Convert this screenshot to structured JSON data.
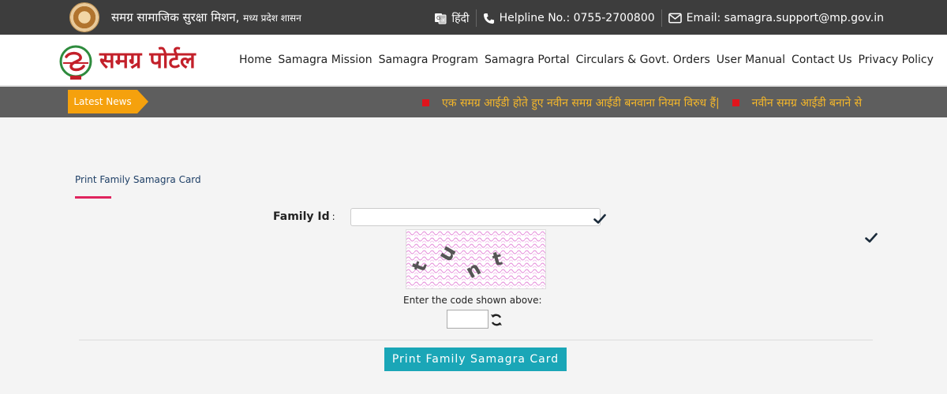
{
  "topbar": {
    "org_name": "समग्र सामाजिक सुरक्षा मिशन,",
    "org_sub": "मध्य प्रदेश शासन",
    "language_label": "हिंदी",
    "helpline": "Helpline No.: 0755-2700800",
    "email": "Email: samagra.support@mp.gov.in"
  },
  "header": {
    "logo_text": "समग्र पोर्टल",
    "nav": [
      "Home",
      "Samagra Mission",
      "Samagra Program",
      "Samagra Portal",
      "Circulars & Govt. Orders",
      "User Manual",
      "Contact Us",
      "Privacy Policy"
    ]
  },
  "news": {
    "label": "Latest News",
    "items": [
      "एक समग्र आईडी होते हुए नवीन समग्र आईडी बनवाना नियम विरुध हैं|",
      "नवीन समग्र आईडी बनाने से"
    ]
  },
  "form": {
    "page_title": "Print Family Samagra Card",
    "family_id_label": "Family Id",
    "family_id_colon": ":",
    "family_id_value": "",
    "captcha_label": "Enter the code shown above:",
    "captcha_value": "",
    "submit_label": "Print Family Samagra Card"
  },
  "colors": {
    "topbar_bg": "#3d3d3d",
    "brand_red": "#c3202a",
    "news_label_bg": "#f5a10d",
    "news_text": "#f5b72a",
    "accent_underline": "#e0245e",
    "button_bg": "#1aa6b7"
  },
  "icons": {
    "language": "translate-icon",
    "phone": "phone-icon",
    "email": "envelope-icon",
    "check": "check-icon",
    "refresh": "refresh-icon"
  }
}
